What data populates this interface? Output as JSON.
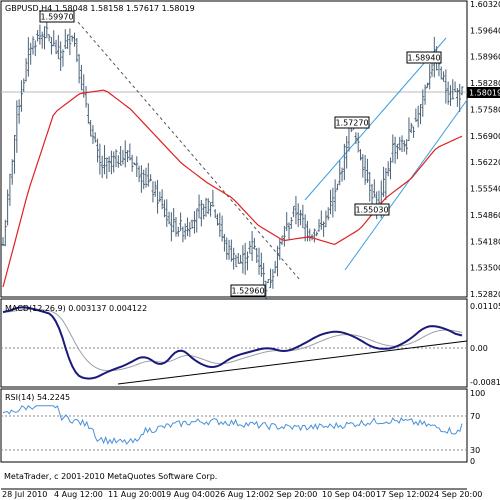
{
  "colors": {
    "background": "#ffffff",
    "frame": "#000000",
    "bar": "#4a6278",
    "ma_line": "#e02020",
    "channel": "#3aa0e0",
    "macd_line": "#1a1a7a",
    "macd_signal": "#9aa0a8",
    "rsi_line": "#4a90d8",
    "grid_dash": "#8a8a8a"
  },
  "price_panel": {
    "header": "GBPUSD,H4  1.58048 1.58158 1.57617 1.58019",
    "ticks": [
      "1.60320",
      "1.59640",
      "1.58960",
      "1.58280",
      "1.57580",
      "1.56900",
      "1.56220",
      "1.55540",
      "1.54860",
      "1.54180",
      "1.53500",
      "1.52820"
    ],
    "current_price": "1.58019",
    "labels": [
      "1.59970",
      "1.52960",
      "1.57270",
      "1.55030",
      "1.58940"
    ]
  },
  "macd_panel": {
    "header": "MACD(12,26,9) 0.003137 0.004122",
    "ticks": [
      "0.011055",
      "0.00",
      "-0.00816"
    ]
  },
  "rsi_panel": {
    "header": "RSI(14) 54.2245",
    "ticks": [
      "100",
      "70",
      "30",
      "0"
    ]
  },
  "footer": "MetaTrader, c 2001-2010 MetaQuotes Software Corp.",
  "time_labels": [
    "28 Jul 2010",
    "4 Aug 12:00",
    "11 Aug 20:00",
    "19 Aug 04:00",
    "26 Aug 12:00",
    "2 Sep 20:00",
    "10 Sep 04:00",
    "17 Sep 12:00",
    "24 Sep 20:00"
  ],
  "chart_data": {
    "type": "line",
    "symbol": "GBPUSD",
    "timeframe": "H4",
    "ohlc_last": {
      "open": 1.58048,
      "high": 1.58158,
      "low": 1.57617,
      "close": 1.58019
    },
    "price_ylim": [
      1.5282,
      1.6032
    ],
    "price_path": [
      [
        "28 Jul 2010",
        1.541
      ],
      [
        "30 Jul",
        1.575
      ],
      [
        "2 Aug",
        1.593
      ],
      [
        "4 Aug 12:00",
        1.596
      ],
      [
        "6 Aug",
        1.59
      ],
      [
        "9 Aug",
        1.596
      ],
      [
        "10 Aug",
        1.575
      ],
      [
        "11 Aug 20:00",
        1.561
      ],
      [
        "13 Aug",
        1.563
      ],
      [
        "16 Aug",
        1.564
      ],
      [
        "17 Aug",
        1.559
      ],
      [
        "19 Aug 04:00",
        1.554
      ],
      [
        "20 Aug",
        1.546
      ],
      [
        "23 Aug",
        1.545
      ],
      [
        "25 Aug",
        1.549
      ],
      [
        "26 Aug 12:00",
        1.552
      ],
      [
        "27 Aug",
        1.54
      ],
      [
        "30 Aug",
        1.536
      ],
      [
        "31 Aug",
        1.541
      ],
      [
        "1 Sep",
        1.5296
      ],
      [
        "2 Sep 20:00",
        1.542
      ],
      [
        "6 Sep",
        1.55
      ],
      [
        "8 Sep",
        1.544
      ],
      [
        "10 Sep 04:00",
        1.546
      ],
      [
        "13 Sep",
        1.555
      ],
      [
        "14 Sep",
        1.5727
      ],
      [
        "15 Sep",
        1.56
      ],
      [
        "16 Sep",
        1.5503
      ],
      [
        "17 Sep 12:00",
        1.566
      ],
      [
        "20 Sep",
        1.567
      ],
      [
        "22 Sep",
        1.577
      ],
      [
        "23 Sep",
        1.5894
      ],
      [
        "24 Sep 20:00",
        1.58
      ],
      [
        "27 Sep",
        1.58019
      ]
    ],
    "ma_path": [
      [
        "28 Jul 2010",
        1.53
      ],
      [
        "30 Jul",
        1.555
      ],
      [
        "2 Aug",
        1.575
      ],
      [
        "4 Aug 12:00",
        1.58
      ],
      [
        "9 Aug",
        1.581
      ],
      [
        "11 Aug 20:00",
        1.576
      ],
      [
        "16 Aug",
        1.569
      ],
      [
        "19 Aug 04:00",
        1.562
      ],
      [
        "23 Aug",
        1.557
      ],
      [
        "26 Aug 12:00",
        1.553
      ],
      [
        "30 Aug",
        1.546
      ],
      [
        "2 Sep 20:00",
        1.542
      ],
      [
        "6 Sep",
        1.543
      ],
      [
        "10 Sep 04:00",
        1.541
      ],
      [
        "14 Sep",
        1.545
      ],
      [
        "17 Sep 12:00",
        1.553
      ],
      [
        "20 Sep",
        1.558
      ],
      [
        "24 Sep 20:00",
        1.566
      ],
      [
        "27 Sep",
        1.569
      ]
    ],
    "macd_ylim": [
      -0.00816,
      0.011055
    ],
    "macd_path": [
      [
        "28 Jul 2010",
        0.009
      ],
      [
        "2 Aug",
        0.0108
      ],
      [
        "4 Aug 12:00",
        0.0098
      ],
      [
        "9 Aug",
        0.0085
      ],
      [
        "11 Aug 20:00",
        -0.006
      ],
      [
        "13 Aug",
        -0.0072
      ],
      [
        "16 Aug",
        -0.005
      ],
      [
        "19 Aug 04:00",
        -0.0035
      ],
      [
        "23 Aug",
        -0.001
      ],
      [
        "24 Aug",
        -0.0042
      ],
      [
        "26 Aug 12:00",
        0.001
      ],
      [
        "27 Aug",
        -0.003
      ],
      [
        "30 Aug",
        -0.0045
      ],
      [
        "1 Sep",
        -0.0015
      ],
      [
        "2 Sep 20:00",
        -0.0003
      ],
      [
        "6 Sep",
        0.0008
      ],
      [
        "8 Sep",
        -0.0005
      ],
      [
        "10 Sep 04:00",
        0.0015
      ],
      [
        "13 Sep",
        0.004
      ],
      [
        "15 Sep",
        0.0048
      ],
      [
        "16 Sep",
        0.0032
      ],
      [
        "17 Sep 12:00",
        0.0005
      ],
      [
        "20 Sep",
        0.0003
      ],
      [
        "22 Sep",
        0.0025
      ],
      [
        "23 Sep",
        0.0062
      ],
      [
        "24 Sep 20:00",
        0.0055
      ],
      [
        "27 Sep",
        0.0032
      ]
    ],
    "rsi_ylim": [
      0,
      100
    ],
    "rsi_levels": [
      70,
      30
    ],
    "rsi_last": 54.2245
  }
}
